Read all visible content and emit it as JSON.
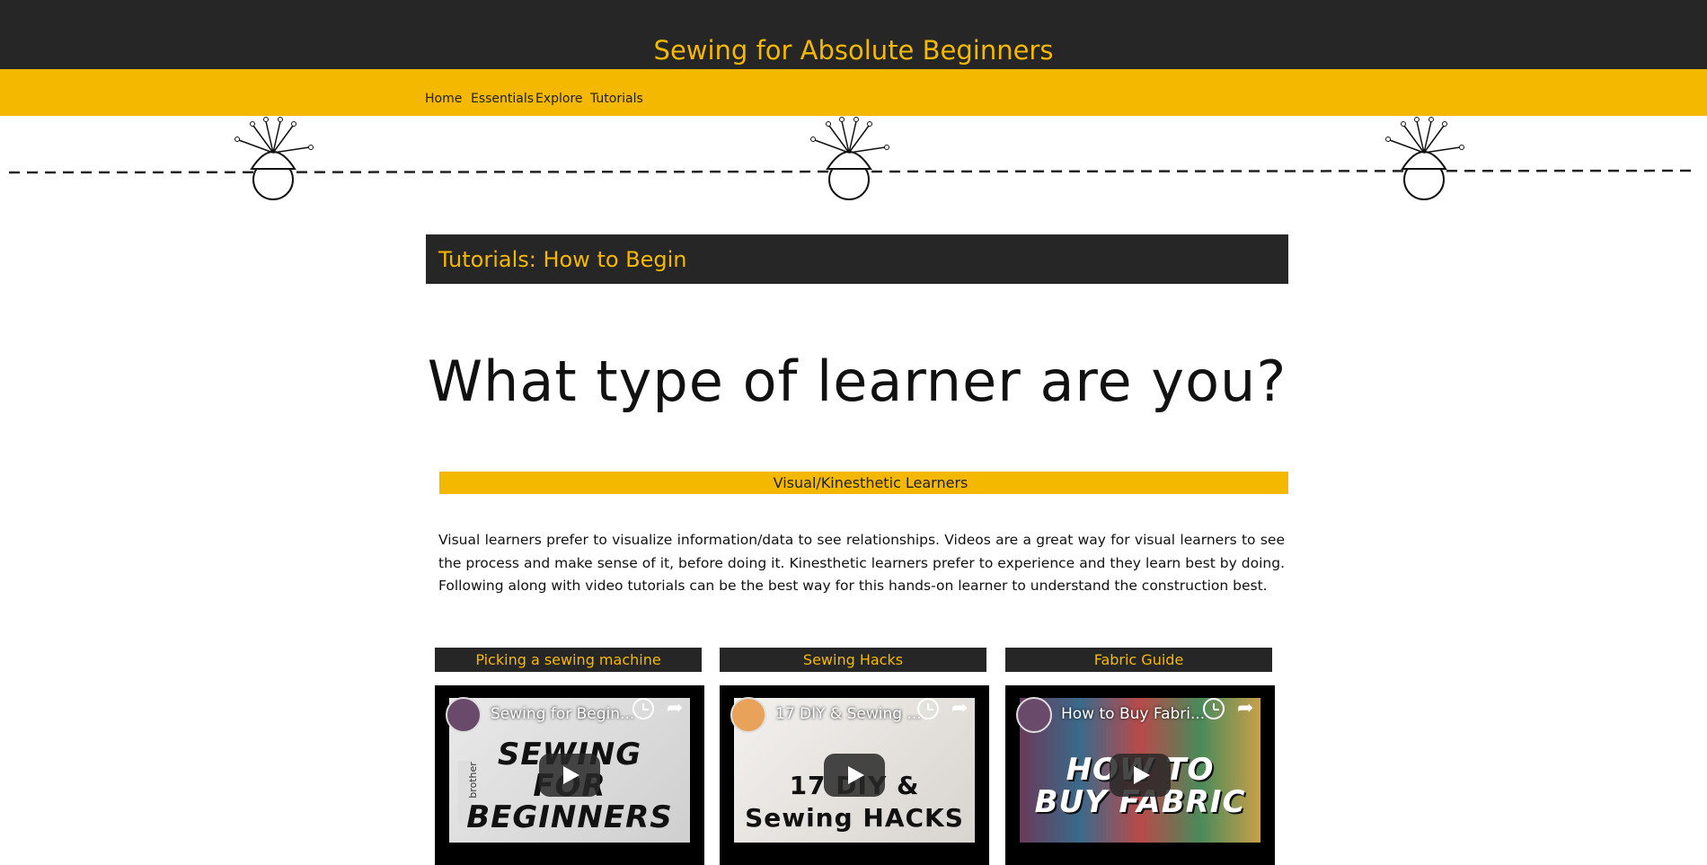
{
  "header": {
    "site_title": "Sewing for Absolute Beginners"
  },
  "nav": {
    "items": [
      {
        "label": "Home"
      },
      {
        "label": "Essentials"
      },
      {
        "label": "Explore"
      },
      {
        "label": "Tutorials"
      }
    ]
  },
  "main": {
    "section_title": "Tutorials: How to Begin",
    "learner_heading": "What type of learner are you?",
    "learner_type": "Visual/Kinesthetic Learners",
    "description": "Visual learners prefer to visualize information/data to see relationships. Videos are a great way for visual learners to see the process and make sense of it, before doing it. Kinesthetic learners prefer to experience and they learn best by doing. Following along with video tutorials can be the best way for this hands-on learner to understand the construction best."
  },
  "videos": [
    {
      "heading": "Picking a sewing machine",
      "player_title": "Sewing for Begin...",
      "thumb_lines": [
        "SEWING",
        "FOR",
        "BEGINNERS"
      ],
      "thumb_small": "brother"
    },
    {
      "heading": "Sewing Hacks",
      "player_title": "17 DIY & Sewing ...",
      "thumb_lines": [
        "17 DIY & Sewing HACKS"
      ]
    },
    {
      "heading": "Fabric Guide",
      "player_title": "How to Buy Fabri...",
      "thumb_lines": [
        "HOW TO",
        "BUY FABRIC"
      ]
    }
  ],
  "colors": {
    "accent": "#f5b800",
    "dark": "#262626",
    "background": "#ffffff"
  }
}
